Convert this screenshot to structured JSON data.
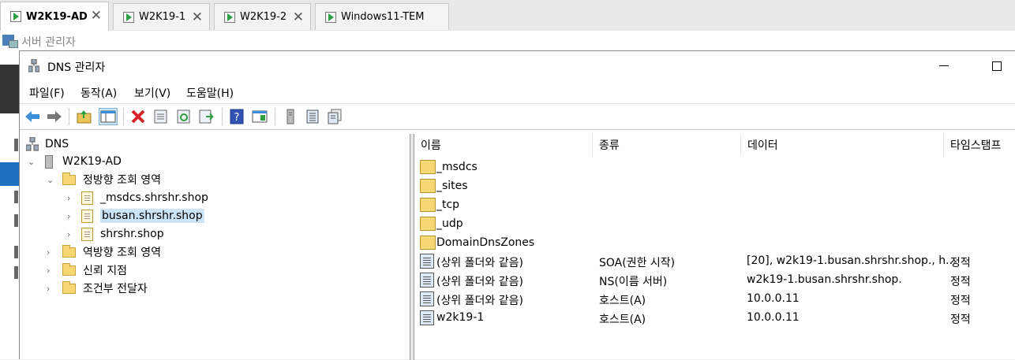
{
  "vm_tabs": [
    {
      "label": "W2K19-AD",
      "active": true
    },
    {
      "label": "W2K19-1",
      "active": false
    },
    {
      "label": "W2K19-2",
      "active": false
    },
    {
      "label": "Windows11-TEM",
      "active": false
    }
  ],
  "server_manager": {
    "title": "서버 관리자"
  },
  "window": {
    "title": "DNS 관리자",
    "menu": [
      "파일(F)",
      "동작(A)",
      "보기(V)",
      "도움말(H)"
    ]
  },
  "toolbar": {
    "icons": [
      "back-arrow-icon",
      "forward-arrow-icon",
      "up-folder-icon",
      "show-hide-tree-icon",
      "delete-icon",
      "properties-icon",
      "refresh-icon",
      "export-list-icon",
      "help-icon",
      "action-pane-icon",
      "server-icon",
      "record-list-icon",
      "records-icon"
    ]
  },
  "tree": {
    "root": "DNS",
    "server": "W2K19-AD",
    "forward_zones": "정방향 조회 영역",
    "zones": [
      "_msdcs.shrshr.shop",
      "busan.shrshr.shop",
      "shrshr.shop"
    ],
    "selected_zone": "busan.shrshr.shop",
    "reverse_zones": "역방향 조회 영역",
    "trust_points": "신뢰 지점",
    "conditional_forwarders": "조건부 전달자"
  },
  "list": {
    "columns": [
      "이름",
      "종류",
      "데이터",
      "타임스탬프"
    ],
    "rows": [
      {
        "name": "_msdcs",
        "type": "",
        "data": "",
        "timestamp": "",
        "icon": "folder"
      },
      {
        "name": "_sites",
        "type": "",
        "data": "",
        "timestamp": "",
        "icon": "folder"
      },
      {
        "name": "_tcp",
        "type": "",
        "data": "",
        "timestamp": "",
        "icon": "folder"
      },
      {
        "name": "_udp",
        "type": "",
        "data": "",
        "timestamp": "",
        "icon": "folder"
      },
      {
        "name": "DomainDnsZones",
        "type": "",
        "data": "",
        "timestamp": "",
        "icon": "folder"
      },
      {
        "name": "(상위 폴더와 같음)",
        "type": "SOA(권한 시작)",
        "data": "[20], w2k19-1.busan.shrshr.shop., h...",
        "timestamp": "정적",
        "icon": "record"
      },
      {
        "name": "(상위 폴더와 같음)",
        "type": "NS(이름 서버)",
        "data": "w2k19-1.busan.shrshr.shop.",
        "timestamp": "정적",
        "icon": "record"
      },
      {
        "name": "(상위 폴더와 같음)",
        "type": "호스트(A)",
        "data": "10.0.0.11",
        "timestamp": "정적",
        "icon": "record"
      },
      {
        "name": "w2k19-1",
        "type": "호스트(A)",
        "data": "10.0.0.11",
        "timestamp": "정적",
        "icon": "record"
      }
    ]
  }
}
